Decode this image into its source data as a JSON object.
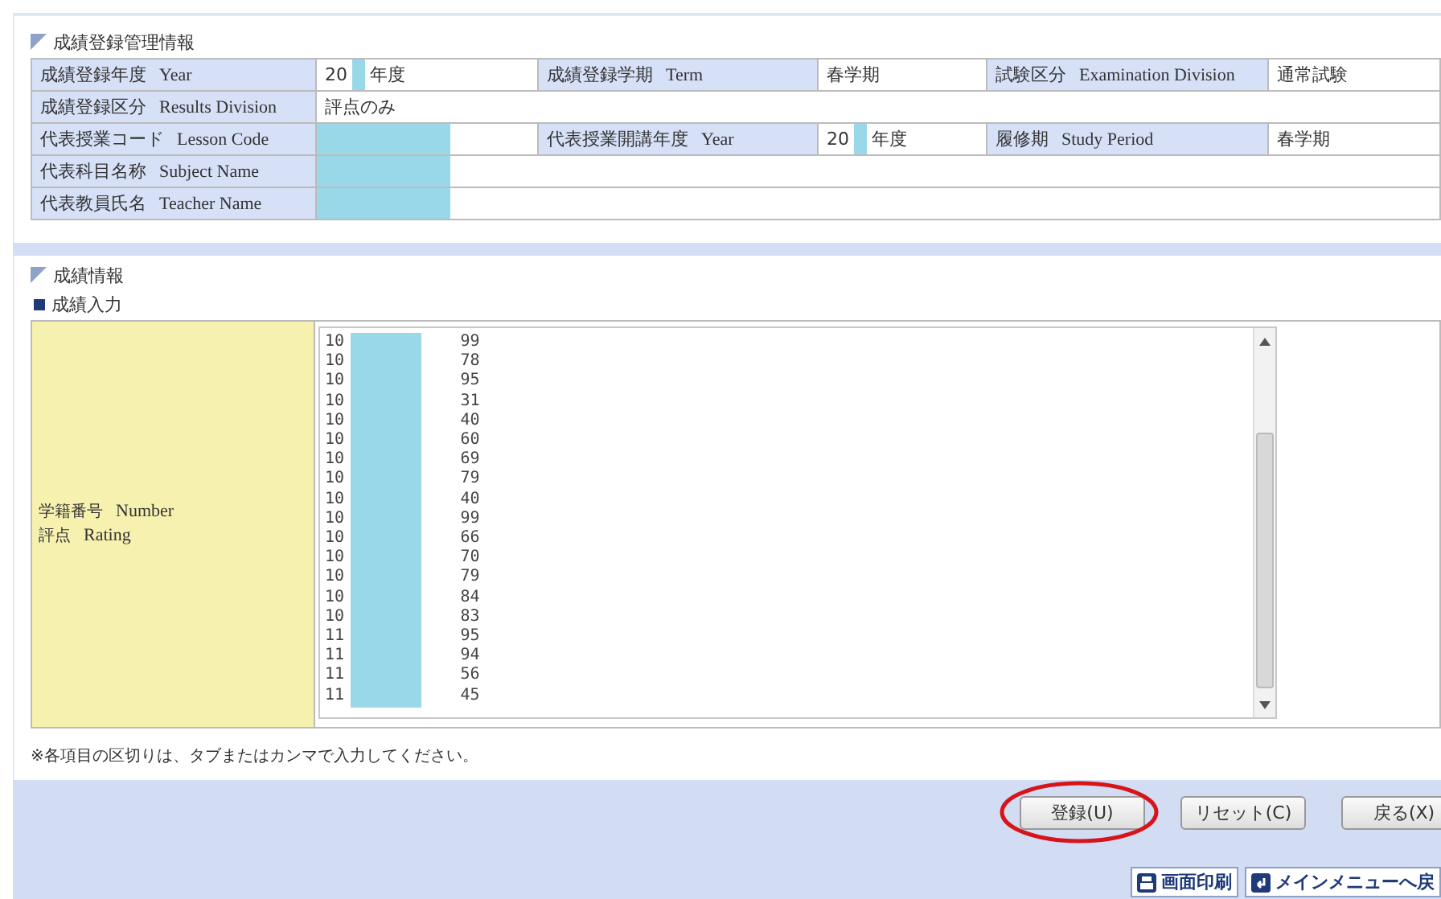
{
  "management": {
    "title": "成績登録管理情報",
    "rows": [
      {
        "cells": [
          {
            "kind": "label",
            "jp": "成績登録年度",
            "en": "Year"
          },
          {
            "kind": "value",
            "text": "20",
            "suffix": "年度",
            "redacted": true
          },
          {
            "kind": "label",
            "jp": "成績登録学期",
            "en": "Term"
          },
          {
            "kind": "value",
            "text": "春学期"
          },
          {
            "kind": "label",
            "jp": "試験区分",
            "en": "Examination Division"
          },
          {
            "kind": "value",
            "text": "通常試験"
          }
        ]
      },
      {
        "cells": [
          {
            "kind": "label",
            "jp": "成績登録区分",
            "en": "Results Division"
          },
          {
            "kind": "wide",
            "text": "評点のみ"
          }
        ]
      },
      {
        "cells": [
          {
            "kind": "label",
            "jp": "代表授業コード",
            "en": "Lesson Code"
          },
          {
            "kind": "value",
            "text": "",
            "redacted": true
          },
          {
            "kind": "label",
            "jp": "代表授業開講年度",
            "en": "Year"
          },
          {
            "kind": "value",
            "text": "20",
            "suffix": "年度",
            "redacted": true
          },
          {
            "kind": "label",
            "jp": "履修期",
            "en": "Study Period"
          },
          {
            "kind": "value",
            "text": "春学期"
          }
        ]
      },
      {
        "cells": [
          {
            "kind": "label",
            "jp": "代表科目名称",
            "en": "Subject Name"
          },
          {
            "kind": "wide",
            "text": "",
            "redacted": true
          }
        ]
      },
      {
        "cells": [
          {
            "kind": "label",
            "jp": "代表教員氏名",
            "en": "Teacher Name"
          },
          {
            "kind": "wide",
            "text": "",
            "redacted": true
          }
        ]
      }
    ]
  },
  "grades": {
    "title": "成績情報",
    "subtitle": "成績入力",
    "label_lines": [
      {
        "jp": "学籍番号",
        "en": "Number"
      },
      {
        "jp": "評点",
        "en": "Rating"
      }
    ],
    "entries": [
      {
        "prefix": "10",
        "score": "99"
      },
      {
        "prefix": "10",
        "score": "78"
      },
      {
        "prefix": "10",
        "score": "95"
      },
      {
        "prefix": "10",
        "score": "31"
      },
      {
        "prefix": "10",
        "score": "40"
      },
      {
        "prefix": "10",
        "score": "60"
      },
      {
        "prefix": "10",
        "score": "69"
      },
      {
        "prefix": "10",
        "score": "79"
      },
      {
        "prefix": "10",
        "score": "40"
      },
      {
        "prefix": "10",
        "score": "99"
      },
      {
        "prefix": "10",
        "score": "66"
      },
      {
        "prefix": "10",
        "score": "70"
      },
      {
        "prefix": "10",
        "score": "79"
      },
      {
        "prefix": "10",
        "score": "84"
      },
      {
        "prefix": "10",
        "score": "83"
      },
      {
        "prefix": "11",
        "score": "95"
      },
      {
        "prefix": "11",
        "score": "94"
      },
      {
        "prefix": "11",
        "score": "56"
      },
      {
        "prefix": "11",
        "score": "45"
      }
    ],
    "note": "※各項目の区切りは、タブまたはカンマで入力してください。"
  },
  "buttons": [
    {
      "label": "登録(U)",
      "circled": true
    },
    {
      "label": "リセット(C)",
      "circled": false
    },
    {
      "label": "戻る(X)",
      "circled": false
    }
  ],
  "footer_links": [
    {
      "label": "画面印刷",
      "kind": "print"
    },
    {
      "label": "メインメニューへ戻",
      "kind": "menu"
    }
  ]
}
